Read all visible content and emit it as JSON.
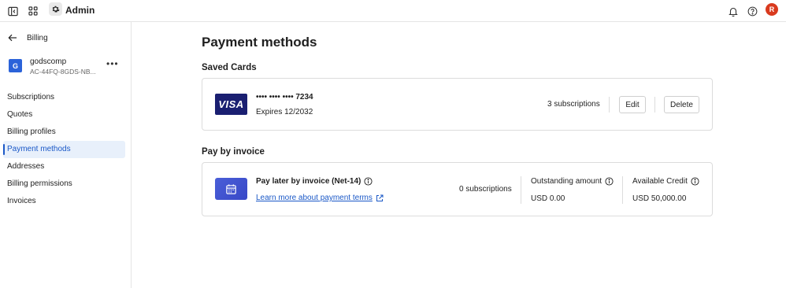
{
  "topbar": {
    "title": "Admin",
    "avatar_initial": "R"
  },
  "sidebar": {
    "back_label": "Billing",
    "org": {
      "initial": "G",
      "name": "godscomp",
      "id": "AC-44FQ-8GDS-NB..."
    },
    "items": [
      {
        "label": "Subscriptions"
      },
      {
        "label": "Quotes"
      },
      {
        "label": "Billing profiles"
      },
      {
        "label": "Payment methods",
        "active": true
      },
      {
        "label": "Addresses"
      },
      {
        "label": "Billing permissions"
      },
      {
        "label": "Invoices"
      }
    ]
  },
  "main": {
    "title": "Payment methods",
    "saved_cards": {
      "heading": "Saved Cards",
      "card": {
        "brand": "VISA",
        "number": "•••• •••• •••• 7234",
        "expires": "Expires 12/2032",
        "subscriptions": "3 subscriptions",
        "edit_label": "Edit",
        "delete_label": "Delete"
      }
    },
    "invoice": {
      "heading": "Pay by invoice",
      "title": "Pay later by invoice (Net-14)",
      "link": "Learn more about payment terms",
      "subscriptions": "0 subscriptions",
      "outstanding_label": "Outstanding amount",
      "outstanding_value": "USD 0.00",
      "credit_label": "Available Credit",
      "credit_value": "USD 50,000.00"
    }
  },
  "colors": {
    "accent": "#1a58c7",
    "visa": "#1a1f71",
    "avatar": "#d93a1e"
  }
}
